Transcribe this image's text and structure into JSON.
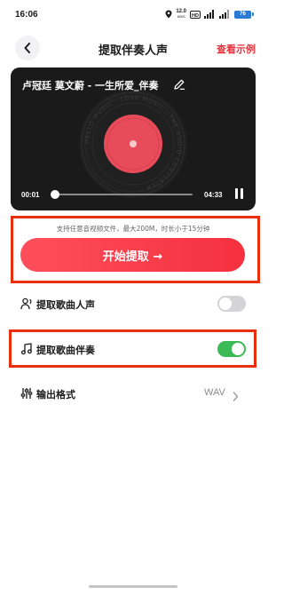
{
  "status_bar": {
    "time": "16:06",
    "net_speed_value": "12.0",
    "net_speed_unit": "KB/S",
    "battery": "76"
  },
  "nav": {
    "title": "提取伴奏人声",
    "example_link": "查看示例"
  },
  "player": {
    "song_title": "卢冠廷 莫文蔚 - 一生所爱_伴奏",
    "time_current": "00:01",
    "time_total": "04:33",
    "progress_fraction": 0.01,
    "vinyl_ring_text": "HELLO MUSIC · LOVE MUSIC · THE AUDIO CONVERTER ·"
  },
  "extract": {
    "support_text": "支持任意音视频文件，最大200M，时长小于15分钟",
    "start_button": "开始提取 →"
  },
  "options": {
    "vocals": {
      "label": "提取歌曲人声",
      "enabled": false
    },
    "accompaniment": {
      "label": "提取歌曲伴奏",
      "enabled": true
    },
    "format": {
      "label": "输出格式",
      "value": "WAV"
    }
  },
  "colors": {
    "accent_red": "#f5303f",
    "toggle_on": "#3cba55",
    "toggle_off": "#d4d4d8",
    "annotation_box": "#e8300f",
    "player_bg": "#1a1a1a"
  },
  "icons": [
    "location-icon",
    "hd-icon",
    "signal-icon",
    "battery-icon",
    "back-chevron-icon",
    "edit-pencil-icon",
    "vinyl-record-icon",
    "pause-icon",
    "vocals-person-icon",
    "music-note-icon",
    "equalizer-icon",
    "chevron-right-icon"
  ]
}
